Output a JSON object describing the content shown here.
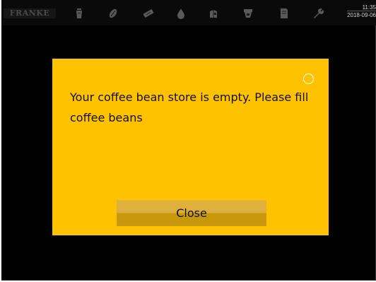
{
  "app": {
    "brand": "FRANKE"
  },
  "status_bar": {
    "time": "11:35",
    "date": "2018-09-06",
    "icons": [
      "beverage-icon",
      "coffee-bean-icon",
      "cleaning-tablet-icon",
      "water-drop-icon",
      "milk-icon",
      "grinder-icon",
      "document-icon",
      "wrench-icon"
    ]
  },
  "dialog": {
    "message": "Your coffee bean store is empty. Please fill coffee beans",
    "close_label": "Close"
  },
  "colors": {
    "screen_background": "#000000",
    "dialog_background": "#ffc200",
    "button_background": "#d9a830",
    "icon_color": "#5a5a5a"
  }
}
